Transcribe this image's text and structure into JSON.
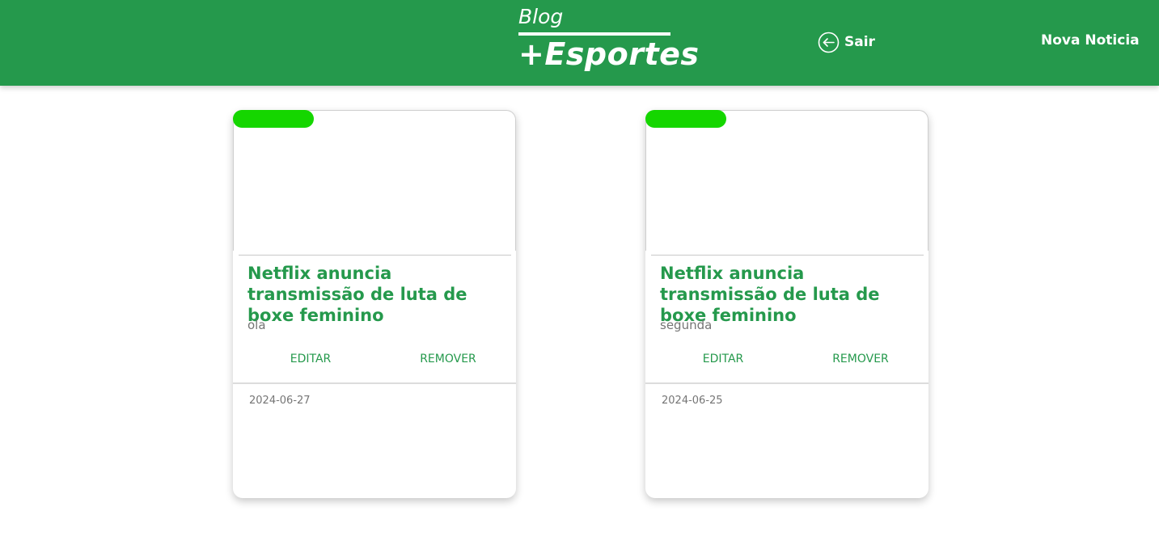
{
  "colors": {
    "header_bg": "#25994c",
    "accent_green": "#25994c",
    "tag_green": "#15d600"
  },
  "header": {
    "logo_top": "Blog",
    "logo_bottom": "+Esportes",
    "logout_icon": "arrow-left-circle-icon",
    "logout_label": "Sair",
    "new_news_label": "Nova Noticia"
  },
  "posts": [
    {
      "title": "Netflix anuncia transmissão de luta de boxe feminino",
      "description": "ola",
      "edit_label": "EDITAR",
      "remove_label": "REMOVER",
      "date": "2024-06-27"
    },
    {
      "title": "Netflix anuncia transmissão de luta de boxe feminino",
      "description": "segunda",
      "edit_label": "EDITAR",
      "remove_label": "REMOVER",
      "date": "2024-06-25"
    }
  ]
}
